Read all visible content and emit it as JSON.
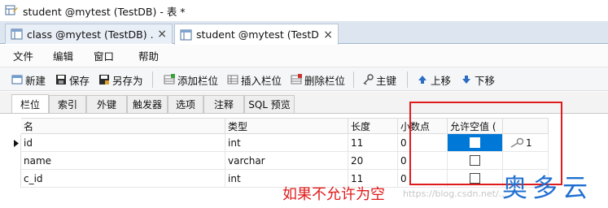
{
  "window": {
    "title": "student @mytest (TestDB) - 表 *"
  },
  "doc_tabs": [
    {
      "label": "class @mytest (TestDB) ...",
      "close": "×"
    },
    {
      "label": "student @mytest (TestD...",
      "close": "×"
    }
  ],
  "menu": [
    "文件",
    "编辑",
    "窗口",
    "帮助"
  ],
  "toolbar": {
    "new": "新建",
    "save": "保存",
    "save_as": "另存为",
    "add_col": "添加栏位",
    "insert_col": "插入栏位",
    "delete_col": "删除栏位",
    "primary_key": "主键",
    "move_up": "上移",
    "move_down": "下移"
  },
  "subtabs": [
    "栏位",
    "索引",
    "外键",
    "触发器",
    "选项",
    "注释",
    "SQL 预览"
  ],
  "table": {
    "headers": {
      "name": "名",
      "type": "类型",
      "length": "长度",
      "decimals": "小数点",
      "nullable": "允许空值 ("
    },
    "rows": [
      {
        "name": "id",
        "type": "int",
        "length": "11",
        "decimals": "0",
        "key": "1"
      },
      {
        "name": "name",
        "type": "varchar",
        "length": "20",
        "decimals": "0",
        "key": ""
      },
      {
        "name": "c_id",
        "type": "int",
        "length": "11",
        "decimals": "0",
        "key": ""
      }
    ]
  },
  "annotation": "如果不允许为空",
  "watermark": "https://blog.csdn.net/...",
  "logo": "奥多云",
  "colors": {
    "accent": "#0078d7",
    "annotation": "#e01b1b",
    "logo": "#1f6fd1"
  }
}
